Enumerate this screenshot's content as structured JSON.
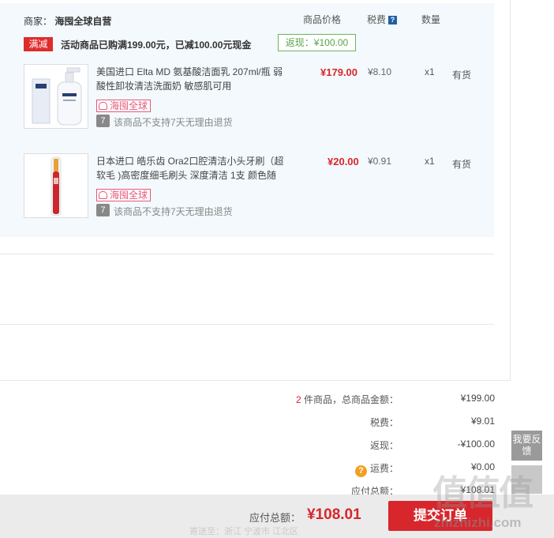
{
  "columns": {
    "price": "商品价格",
    "tax": "税费",
    "tax_help": "?",
    "qty": "数量"
  },
  "merchant": {
    "label": "商家：",
    "name": "海囤全球自营"
  },
  "promo": {
    "tag": "满减",
    "text": "活动商品已购满199.00元，已减100.00元现金",
    "rebate": "返现：¥100.00"
  },
  "items": [
    {
      "name": "美国进口 Elta MD 氨基酸洁面乳 207ml/瓶 弱酸性卸妆清洁洗面奶 敏感肌可用",
      "badge": "海囤全球",
      "return_icon": "7",
      "return_text": "该商品不支持7天无理由退货",
      "price": "¥179.00",
      "tax": "¥8.10",
      "qty": "x1",
      "stock": "有货"
    },
    {
      "name": "日本进口 皓乐齿 Ora2口腔清洁小头牙刷（超软毛 )高密度细毛刷头 深度清洁 1支 颜色随",
      "badge": "海囤全球",
      "return_icon": "7",
      "return_text": "该商品不支持7天无理由退货",
      "price": "¥20.00",
      "tax": "¥0.91",
      "qty": "x1",
      "stock": "有货"
    }
  ],
  "summary": {
    "count": "2",
    "count_suffix": " 件商品，总商品金额：",
    "goods_total": "¥199.00",
    "tax_label": "税费：",
    "tax_value": "¥9.01",
    "rebate_label": "返现：",
    "rebate_value": "-¥100.00",
    "ship_icon": "?",
    "ship_label": "运费：",
    "ship_value": "¥0.00",
    "payable_label": "应付总额：",
    "payable_value": "¥108.01"
  },
  "bottom": {
    "pay_label": "应付总额：",
    "pay_amount": "¥108.01",
    "submit": "提交订单",
    "faint": "寄送至：浙江 宁波市 江北区"
  },
  "side": {
    "feedback": "我要反馈"
  },
  "watermark": {
    "big": "值值值",
    "small": "zhizhizhi.com"
  }
}
